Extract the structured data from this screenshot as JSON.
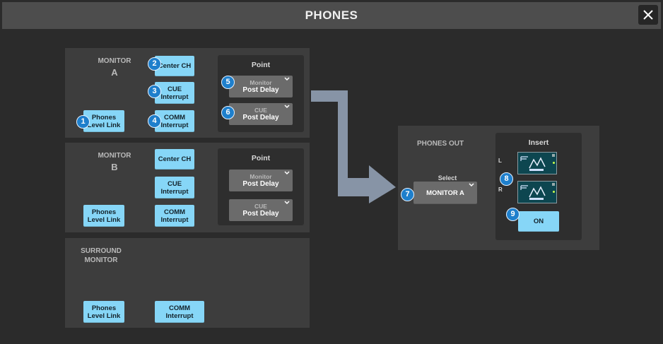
{
  "window": {
    "title": "PHONES",
    "close_icon": "close-icon"
  },
  "monitor_a": {
    "label_line1": "MONITOR",
    "label_line2": "A",
    "center_ch": "Center CH",
    "cue_interrupt_1": "CUE",
    "cue_interrupt_2": "Interrupt",
    "comm_interrupt_1": "COMM",
    "comm_interrupt_2": "Interrupt",
    "phones_link_1": "Phones",
    "phones_link_2": "Level Link",
    "point_title": "Point",
    "monitor_point_1": "Monitor",
    "monitor_point_2": "Post Delay",
    "cue_point_1": "CUE",
    "cue_point_2": "Post Delay"
  },
  "monitor_b": {
    "label_line1": "MONITOR",
    "label_line2": "B",
    "center_ch": "Center CH",
    "cue_interrupt_1": "CUE",
    "cue_interrupt_2": "Interrupt",
    "comm_interrupt_1": "COMM",
    "comm_interrupt_2": "Interrupt",
    "phones_link_1": "Phones",
    "phones_link_2": "Level Link",
    "point_title": "Point",
    "monitor_point_1": "Monitor",
    "monitor_point_2": "Post Delay",
    "cue_point_1": "CUE",
    "cue_point_2": "Post Delay"
  },
  "surround": {
    "label_line1": "SURROUND",
    "label_line2": "MONITOR",
    "phones_link_1": "Phones",
    "phones_link_2": "Level Link",
    "comm_interrupt_1": "COMM",
    "comm_interrupt_2": "Interrupt"
  },
  "phones_out": {
    "label": "PHONES OUT",
    "select_label": "Select",
    "select_value": "MONITOR A",
    "insert_title": "Insert",
    "left_label": "L",
    "right_label": "R",
    "insert_on": "ON"
  },
  "badges": [
    "1",
    "2",
    "3",
    "4",
    "5",
    "6",
    "7",
    "8",
    "9"
  ],
  "colors": {
    "button": "#86d6f7",
    "badge": "#1e7fcc",
    "panel": "#3d3d3d",
    "arrow": "#8794a6"
  }
}
